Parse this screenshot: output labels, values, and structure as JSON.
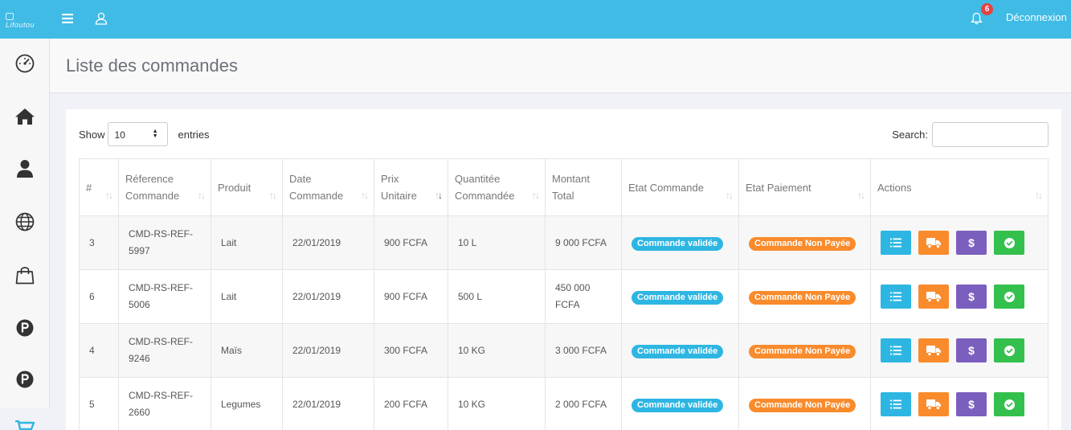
{
  "topbar": {
    "logo_text": "Lifoutou",
    "notification_count": "6",
    "logout_label": "Déconnexion",
    "bg_color": "#3fbbe6"
  },
  "sidebar": {
    "items": [
      {
        "icon": "dashboard-gauge-icon"
      },
      {
        "icon": "home-icon"
      },
      {
        "icon": "user-icon"
      },
      {
        "icon": "globe-icon"
      },
      {
        "icon": "shopping-bag-icon"
      },
      {
        "icon": "parking-p-icon"
      },
      {
        "icon": "parking-p-icon"
      },
      {
        "icon": "cart-icon"
      }
    ]
  },
  "page": {
    "title": "Liste des commandes"
  },
  "table_controls": {
    "show_label": "Show",
    "entries_value": "10",
    "entries_label": "entries",
    "search_label": "Search:"
  },
  "table": {
    "columns": [
      {
        "line1": "#",
        "line2": ""
      },
      {
        "line1": "Réference",
        "line2": "Commande"
      },
      {
        "line1": "Produit",
        "line2": ""
      },
      {
        "line1": "Date",
        "line2": "Commande"
      },
      {
        "line1": "Prix",
        "line2": "Unitaire"
      },
      {
        "line1": "Quantitée",
        "line2": "Commandée"
      },
      {
        "line1": "Montant",
        "line2": "Total"
      },
      {
        "line1": "Etat Commande",
        "line2": ""
      },
      {
        "line1": "Etat Paiement",
        "line2": ""
      },
      {
        "line1": "Actions",
        "line2": ""
      }
    ],
    "rows": [
      {
        "id": "3",
        "ref1": "CMD-RS-REF-",
        "ref2": "5997",
        "product": "Lait",
        "date": "22/01/2019",
        "price": "900 FCFA",
        "qty": "10 L",
        "total1": "9 000 FCFA",
        "total2": "",
        "order_state": "Commande validée",
        "payment_state": "Commande Non Payée"
      },
      {
        "id": "6",
        "ref1": "CMD-RS-REF-",
        "ref2": "5006",
        "product": "Lait",
        "date": "22/01/2019",
        "price": "900 FCFA",
        "qty": "500 L",
        "total1": "450 000",
        "total2": "FCFA",
        "order_state": "Commande validée",
        "payment_state": "Commande Non Payée"
      },
      {
        "id": "4",
        "ref1": "CMD-RS-REF-",
        "ref2": "9246",
        "product": "Maïs",
        "date": "22/01/2019",
        "price": "300 FCFA",
        "qty": "10 KG",
        "total1": "3 000 FCFA",
        "total2": "",
        "order_state": "Commande validée",
        "payment_state": "Commande Non Payée"
      },
      {
        "id": "5",
        "ref1": "CMD-RS-REF-",
        "ref2": "2660",
        "product": "Legumes",
        "date": "22/01/2019",
        "price": "200 FCFA",
        "qty": "10 KG",
        "total1": "2 000 FCFA",
        "total2": "",
        "order_state": "Commande validée",
        "payment_state": "Commande Non Payée"
      }
    ],
    "action_icons": [
      "list-icon",
      "truck-icon",
      "dollar-icon",
      "check-circle-icon"
    ],
    "dollar_glyph": "$"
  }
}
